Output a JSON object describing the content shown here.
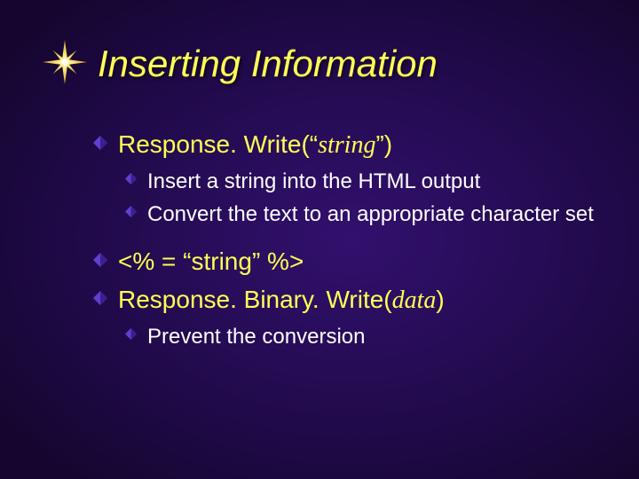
{
  "title": "Inserting Information",
  "b": {
    "0": {
      "a": "Response. Write(“",
      "b": "string",
      "c": "”)"
    },
    "1": "Insert a string into the HTML output",
    "2": "Convert the text to an appropriate character set",
    "3": "<% = “string” %>",
    "4": {
      "a": "Response. Binary. Write(",
      "b": "data",
      "c": ")"
    },
    "5": "Prevent the conversion"
  }
}
